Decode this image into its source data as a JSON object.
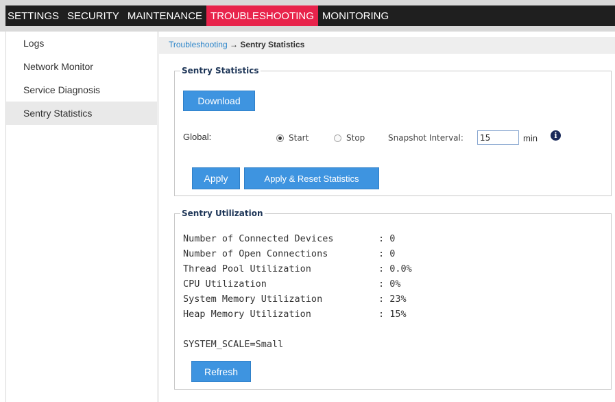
{
  "nav": {
    "tabs": [
      {
        "label": "SETTINGS"
      },
      {
        "label": "SECURITY"
      },
      {
        "label": "MAINTENANCE"
      },
      {
        "label": "TROUBLESHOOTING"
      },
      {
        "label": "MONITORING"
      }
    ],
    "active_index": 3,
    "colors": {
      "bar": "#1f1f1f",
      "active": "#e8234b"
    }
  },
  "sidebar": {
    "items": [
      {
        "label": "Logs"
      },
      {
        "label": "Network Monitor"
      },
      {
        "label": "Service Diagnosis"
      },
      {
        "label": "Sentry Statistics"
      }
    ],
    "active_index": 3
  },
  "breadcrumb": {
    "link": "Troubleshooting",
    "arrow": "→",
    "current": "Sentry Statistics"
  },
  "stats_panel": {
    "legend": "Sentry Statistics",
    "download_label": "Download",
    "global_label": "Global:",
    "start_label": "Start",
    "stop_label": "Stop",
    "selected": "Start",
    "interval_label": "Snapshot Interval:",
    "interval_value": "15",
    "interval_unit": "min",
    "info_icon": "i",
    "apply_label": "Apply",
    "apply_reset_label": "Apply & Reset Statistics"
  },
  "util_panel": {
    "legend": "Sentry Utilization",
    "rows": [
      {
        "label": "Number of Connected Devices",
        "value": ": 0"
      },
      {
        "label": "Number of Open Connections",
        "value": ": 0"
      },
      {
        "label": "Thread Pool Utilization",
        "value": ": 0.0%"
      },
      {
        "label": "CPU Utilization",
        "value": ": 0%"
      },
      {
        "label": "System Memory Utilization",
        "value": ": 23%"
      },
      {
        "label": "Heap Memory Utilization",
        "value": ": 15%"
      }
    ],
    "scale_text": "SYSTEM_SCALE=Small",
    "refresh_label": "Refresh"
  },
  "accent_color": "#3e94e0"
}
